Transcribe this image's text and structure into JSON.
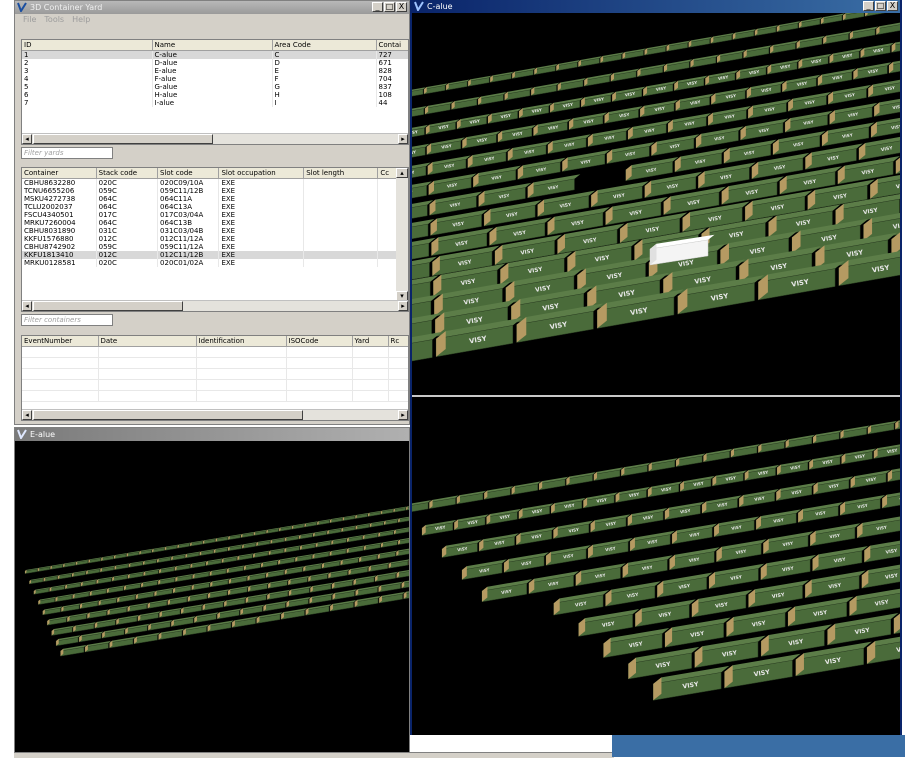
{
  "main_window": {
    "title": "3D Container Yard",
    "menu": [
      "File",
      "Tools",
      "Help"
    ],
    "controls": [
      "_",
      "□",
      "X"
    ],
    "yards_table": {
      "columns": [
        "ID",
        "Name",
        "Area Code",
        "Contai"
      ],
      "rows": [
        [
          "1",
          "C-alue",
          "C",
          "727"
        ],
        [
          "2",
          "D-alue",
          "D",
          "671"
        ],
        [
          "3",
          "E-alue",
          "E",
          "828"
        ],
        [
          "4",
          "F-alue",
          "F",
          "704"
        ],
        [
          "5",
          "G-alue",
          "G",
          "837"
        ],
        [
          "6",
          "H-alue",
          "H",
          "108"
        ],
        [
          "7",
          "I-alue",
          "I",
          "44"
        ]
      ],
      "selected_row": 0
    },
    "filter_yards_placeholder": "Filter yards",
    "containers_table": {
      "columns": [
        "Container",
        "Stack code",
        "Slot code",
        "Slot occupation",
        "Slot length",
        "Cc"
      ],
      "rows": [
        [
          "CBHU8632280",
          "020C",
          "020C09/10A",
          "EXE",
          "",
          ""
        ],
        [
          "TCNU6655206",
          "059C",
          "059C11/12B",
          "EXE",
          "",
          ""
        ],
        [
          "MSKU4272738",
          "064C",
          "064C11A",
          "EXE",
          "",
          ""
        ],
        [
          "TCLU2002037",
          "064C",
          "064C13A",
          "EXE",
          "",
          ""
        ],
        [
          "FSCU4340501",
          "017C",
          "017C03/04A",
          "EXE",
          "",
          ""
        ],
        [
          "MRKU7260004",
          "064C",
          "064C13B",
          "EXE",
          "",
          ""
        ],
        [
          "CBHU8031890",
          "031C",
          "031C03/04B",
          "EXE",
          "",
          ""
        ],
        [
          "KKFU1576880",
          "012C",
          "012C11/12A",
          "EXE",
          "",
          ""
        ],
        [
          "CBHU8742902",
          "059C",
          "059C11/12A",
          "EXE",
          "",
          ""
        ],
        [
          "KKFU1813410",
          "012C",
          "012C11/12B",
          "EXE",
          "",
          ""
        ],
        [
          "MRKU0128581",
          "020C",
          "020C01/02A",
          "EXE",
          "",
          ""
        ]
      ],
      "selected_row": 9
    },
    "filter_containers_placeholder": "Filter containers",
    "events_table": {
      "columns": [
        "EventNumber",
        "Date",
        "Identification",
        "ISOCode",
        "Yard",
        "Rc"
      ]
    }
  },
  "c_window": {
    "title": "C-alue",
    "controls": [
      "_",
      "□",
      "X"
    ],
    "container_brand": "VISY"
  },
  "e_window": {
    "title": "E-alue"
  },
  "colors": {
    "container_green": "#4a6b3a",
    "container_dark": "#2b3f22",
    "container_door": "#b59a62",
    "highlight_container": "#f4f4f4",
    "active_title": "#0a246a",
    "scene_bg": "#000000"
  }
}
